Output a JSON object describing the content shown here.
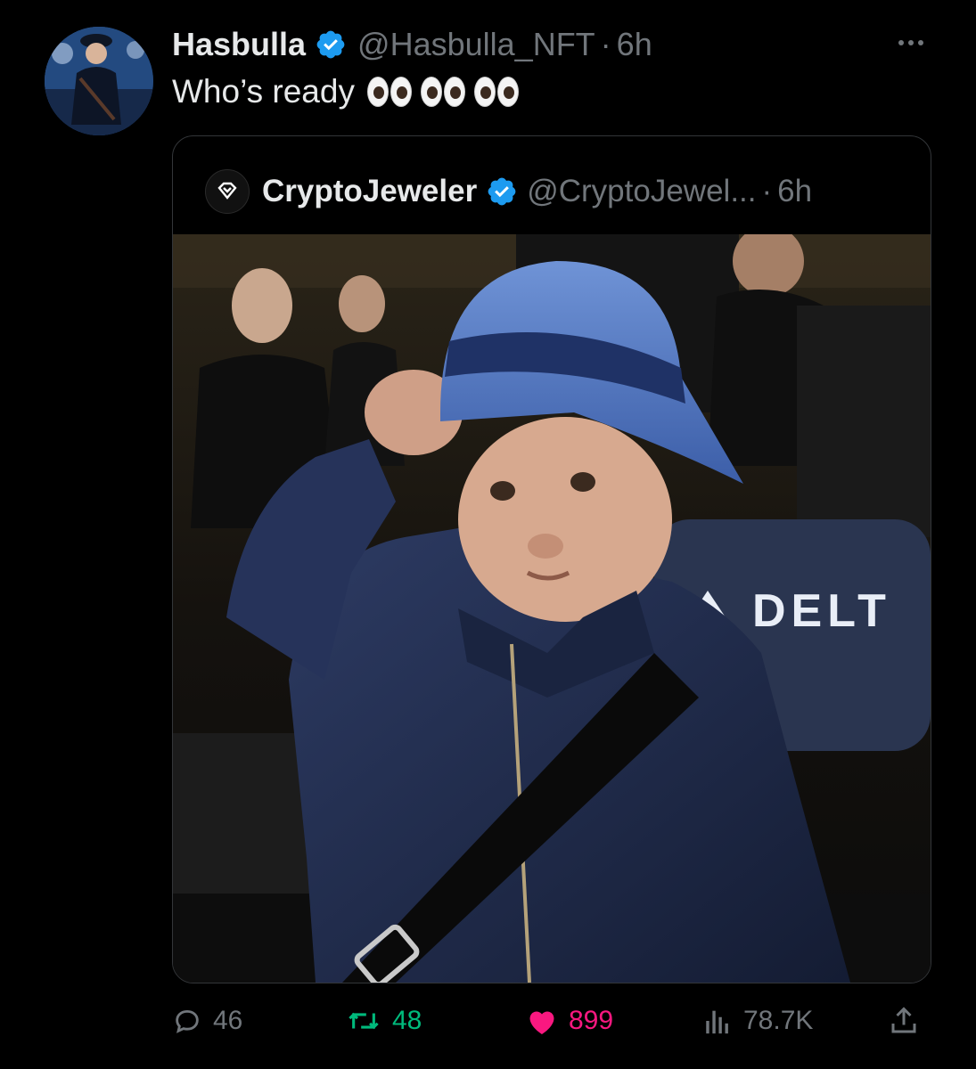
{
  "tweet": {
    "author": {
      "display_name": "Hasbulla",
      "handle": "@Hasbulla_NFT",
      "separator": "·",
      "time": "6h"
    },
    "text": "Who’s ready",
    "emoji": "eyes-emoji x3",
    "quoted": {
      "display_name": "CryptoJeweler",
      "handle": "@CryptoJewel...",
      "separator": "·",
      "time": "6h",
      "photo_sign_text": "DELT"
    },
    "actions": {
      "replies": "46",
      "retweets": "48",
      "likes": "899",
      "views": "78.7K"
    }
  },
  "colors": {
    "background": "#000000",
    "text": "#e7e9ea",
    "muted": "#71767b",
    "verified": "#1d9bf0",
    "retweet": "#00ba7c",
    "like": "#f91880",
    "border": "#333639"
  },
  "icons": [
    "verified-badge-icon",
    "more-icon",
    "crypto-jeweler-logo-icon",
    "reply-icon",
    "retweet-icon",
    "heart-icon",
    "views-icon",
    "share-icon"
  ]
}
